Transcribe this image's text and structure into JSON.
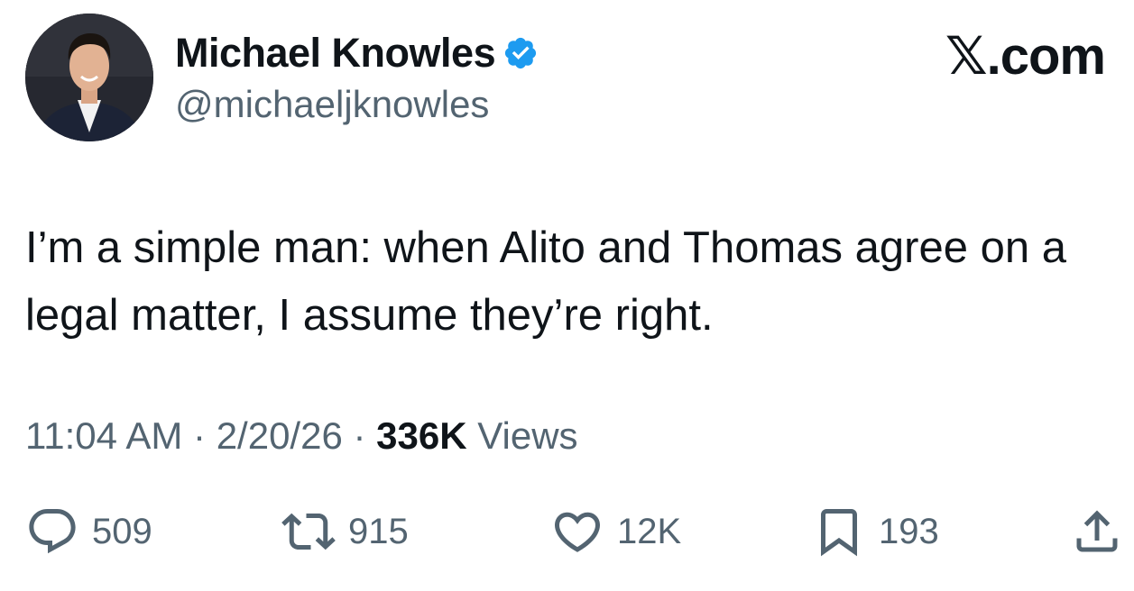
{
  "author": {
    "display_name": "Michael Knowles",
    "handle": "@michaeljknowles",
    "verified": true,
    "verified_color": "#1d9bf0"
  },
  "brand": {
    "logo_text": "𝕏.com"
  },
  "tweet": {
    "text": "I’m a simple man: when Alito and Thomas agree on a legal matter, I assume they’re right."
  },
  "meta": {
    "time": "11:04 AM",
    "separator": "·",
    "date": "2/20/26",
    "views_count": "336K",
    "views_label": "Views"
  },
  "actions": {
    "reply": {
      "icon": "reply-icon",
      "count": "509"
    },
    "retweet": {
      "icon": "retweet-icon",
      "count": "915"
    },
    "like": {
      "icon": "heart-icon",
      "count": "12K"
    },
    "bookmark": {
      "icon": "bookmark-icon",
      "count": "193"
    },
    "share": {
      "icon": "share-icon"
    }
  },
  "colors": {
    "text_primary": "#0f1419",
    "text_secondary": "#536471"
  }
}
